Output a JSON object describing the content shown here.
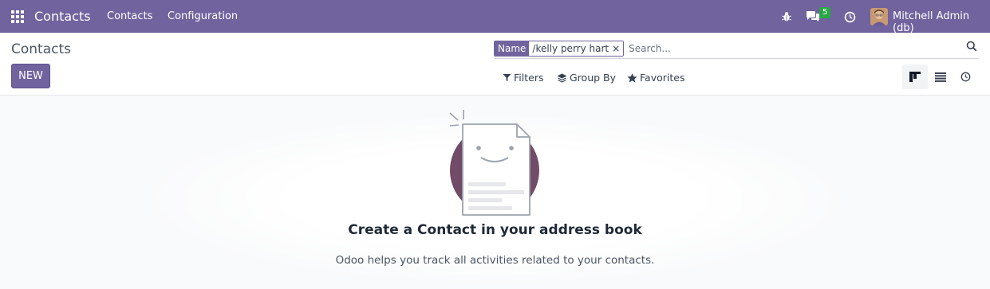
{
  "navbar": {
    "brand": "Contacts",
    "menu": [
      {
        "label": "Contacts"
      },
      {
        "label": "Configuration"
      }
    ],
    "messages_count": "5",
    "user_name": "Mitchell Admin (db)",
    "icons": [
      "apps-grid-icon",
      "bug-icon",
      "chat-icon",
      "clock-icon"
    ],
    "accent_color": "#71639e"
  },
  "control_panel": {
    "title": "Contacts",
    "new_label": "NEW",
    "search": {
      "facet_label": "Name",
      "facet_value": "/kelly perry hart",
      "facet_remove": "×",
      "placeholder": "Search..."
    },
    "filters_label": "Filters",
    "group_by_label": "Group By",
    "favorites_label": "Favorites",
    "views": [
      "kanban",
      "list",
      "activity"
    ],
    "active_view": "kanban"
  },
  "empty_state": {
    "title": "Create a Contact in your address book",
    "help": "Odoo helps you track all activities related to your contacts."
  }
}
